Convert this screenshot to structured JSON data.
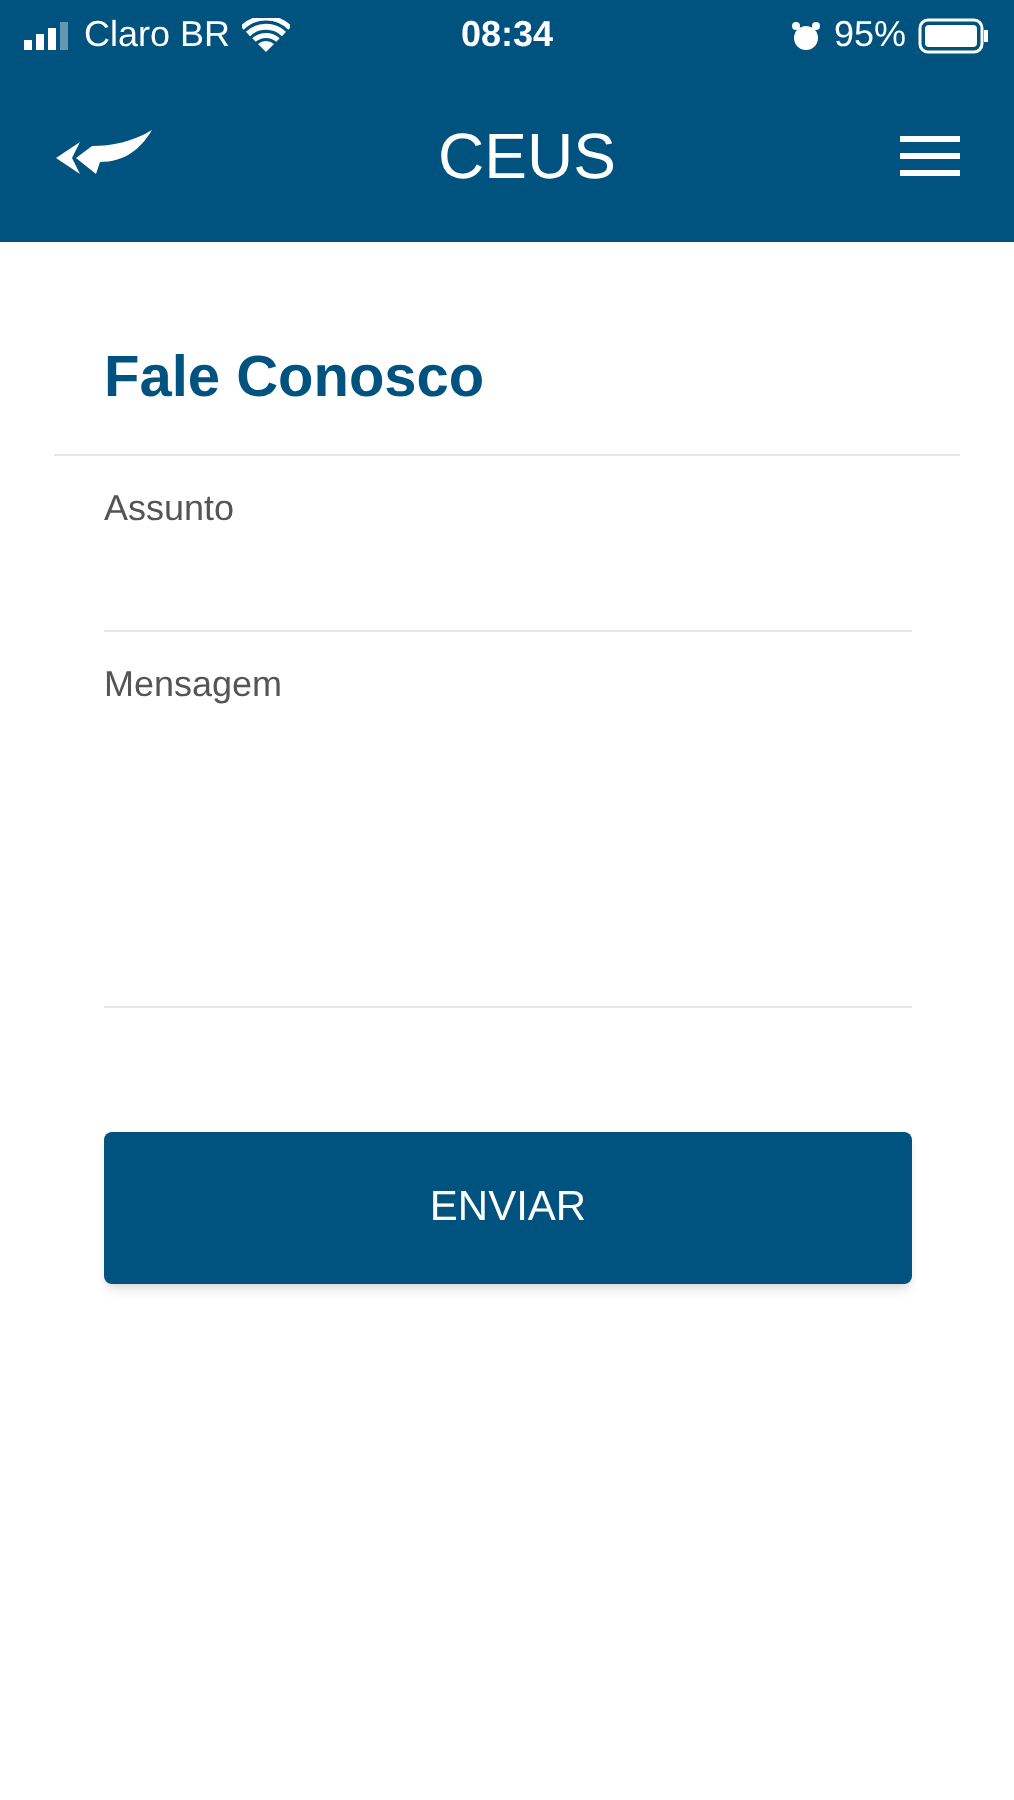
{
  "status_bar": {
    "carrier": "Claro BR",
    "time": "08:34",
    "battery": "95%"
  },
  "nav": {
    "title": "CEUS"
  },
  "page": {
    "title": "Fale Conosco"
  },
  "fields": [
    {
      "kind": "line",
      "label": "Assunto"
    },
    {
      "kind": "area",
      "label": "Mensagem"
    }
  ],
  "submit": {
    "label": "ENVIAR"
  }
}
